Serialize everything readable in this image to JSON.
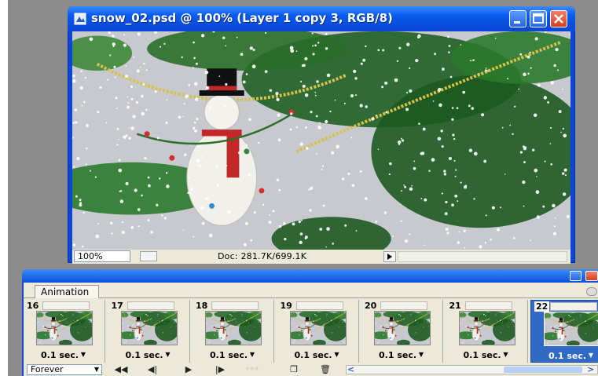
{
  "window": {
    "title": "snow_02.psd @ 100% (Layer 1 copy 3, RGB/8)"
  },
  "statusbar": {
    "zoom": "100%",
    "doc_info": "Doc: 281.7K/699.1K"
  },
  "animation_panel": {
    "tab_label": "Animation",
    "frames": [
      {
        "number": "16",
        "delay": "0.1 sec."
      },
      {
        "number": "17",
        "delay": "0.1 sec."
      },
      {
        "number": "18",
        "delay": "0.1 sec."
      },
      {
        "number": "19",
        "delay": "0.1 sec."
      },
      {
        "number": "20",
        "delay": "0.1 sec."
      },
      {
        "number": "21",
        "delay": "0.1 sec."
      },
      {
        "number": "22",
        "delay": "0.1 sec.",
        "selected": true
      }
    ],
    "loop_option": "Forever"
  },
  "colors": {
    "xp_blue": "#0a46d8",
    "selection": "#316ac5",
    "panel_bg": "#ece9d8",
    "workspace_gray": "#8c8c8c"
  },
  "icons": [
    "photoshop-doc-icon",
    "minimize-icon",
    "maximize-icon",
    "close-icon",
    "play-icon",
    "first-frame-icon",
    "prev-frame-icon",
    "next-frame-icon",
    "tween-icon",
    "new-frame-icon",
    "delete-frame-icon"
  ]
}
